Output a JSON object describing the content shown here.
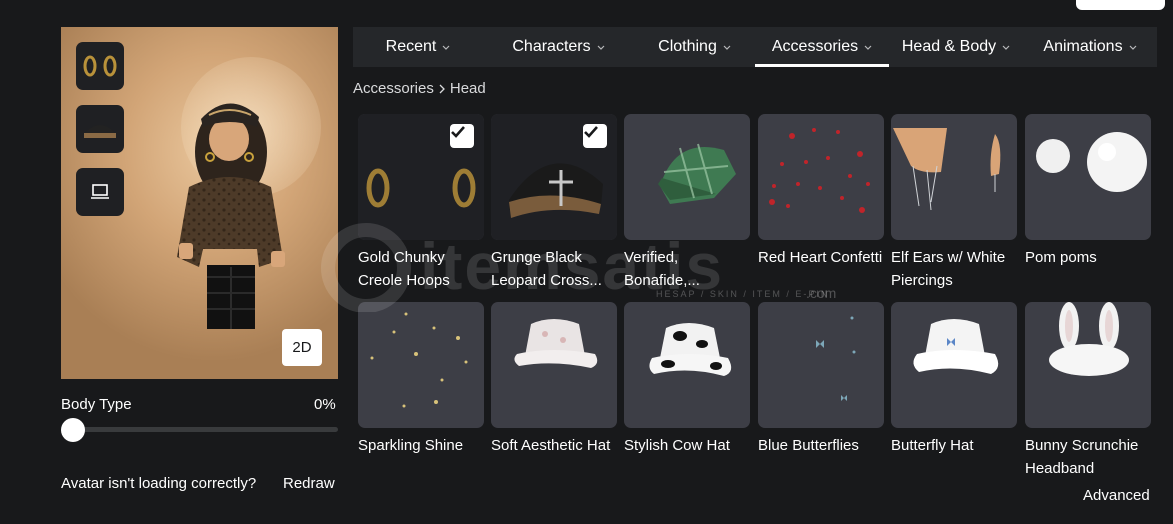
{
  "avatar": {
    "view_mode_label": "2D",
    "body_type_label": "Body Type",
    "body_type_value": "0%",
    "body_type_level": 0,
    "loading_message": "Avatar isn't loading correctly?",
    "redraw_label": "Redraw"
  },
  "tabs": [
    {
      "label": "Recent",
      "active": false
    },
    {
      "label": "Characters",
      "active": false
    },
    {
      "label": "Clothing",
      "active": false
    },
    {
      "label": "Accessories",
      "active": true
    },
    {
      "label": "Head & Body",
      "active": false
    },
    {
      "label": "Animations",
      "active": false
    }
  ],
  "breadcrumb": {
    "parent": "Accessories",
    "current": "Head"
  },
  "items": [
    {
      "name": "Gold Chunky Creole Hoops",
      "selected": true,
      "icon": "gold-hoops-icon"
    },
    {
      "name": "Grunge Black Leopard Cross...",
      "selected": true,
      "icon": "leopard-cap-icon"
    },
    {
      "name": "Verified, Bonafide,...",
      "selected": false,
      "icon": "green-plaid-cap-icon"
    },
    {
      "name": "Red Heart Confetti",
      "selected": false,
      "icon": "heart-confetti-icon"
    },
    {
      "name": "Elf Ears w/ White Piercings",
      "selected": false,
      "icon": "elf-ears-icon"
    },
    {
      "name": "Pom poms",
      "selected": false,
      "icon": "pom-poms-icon"
    },
    {
      "name": "Sparkling Shine",
      "selected": false,
      "icon": "sparkles-icon"
    },
    {
      "name": "Soft Aesthetic Hat",
      "selected": false,
      "icon": "bucket-hat-icon"
    },
    {
      "name": "Stylish Cow Hat",
      "selected": false,
      "icon": "cow-hat-icon"
    },
    {
      "name": "Blue Butterflies",
      "selected": false,
      "icon": "butterflies-icon"
    },
    {
      "name": "Butterfly Hat",
      "selected": false,
      "icon": "butterfly-hat-icon"
    },
    {
      "name": "Bunny Scrunchie Headband",
      "selected": false,
      "icon": "bunny-headband-icon"
    }
  ],
  "advanced_label": "Advanced",
  "watermark": {
    "text": "itemsatis",
    "sub": "HESAP / SKIN / ITEM / E-PIN",
    "domain": ".com"
  }
}
